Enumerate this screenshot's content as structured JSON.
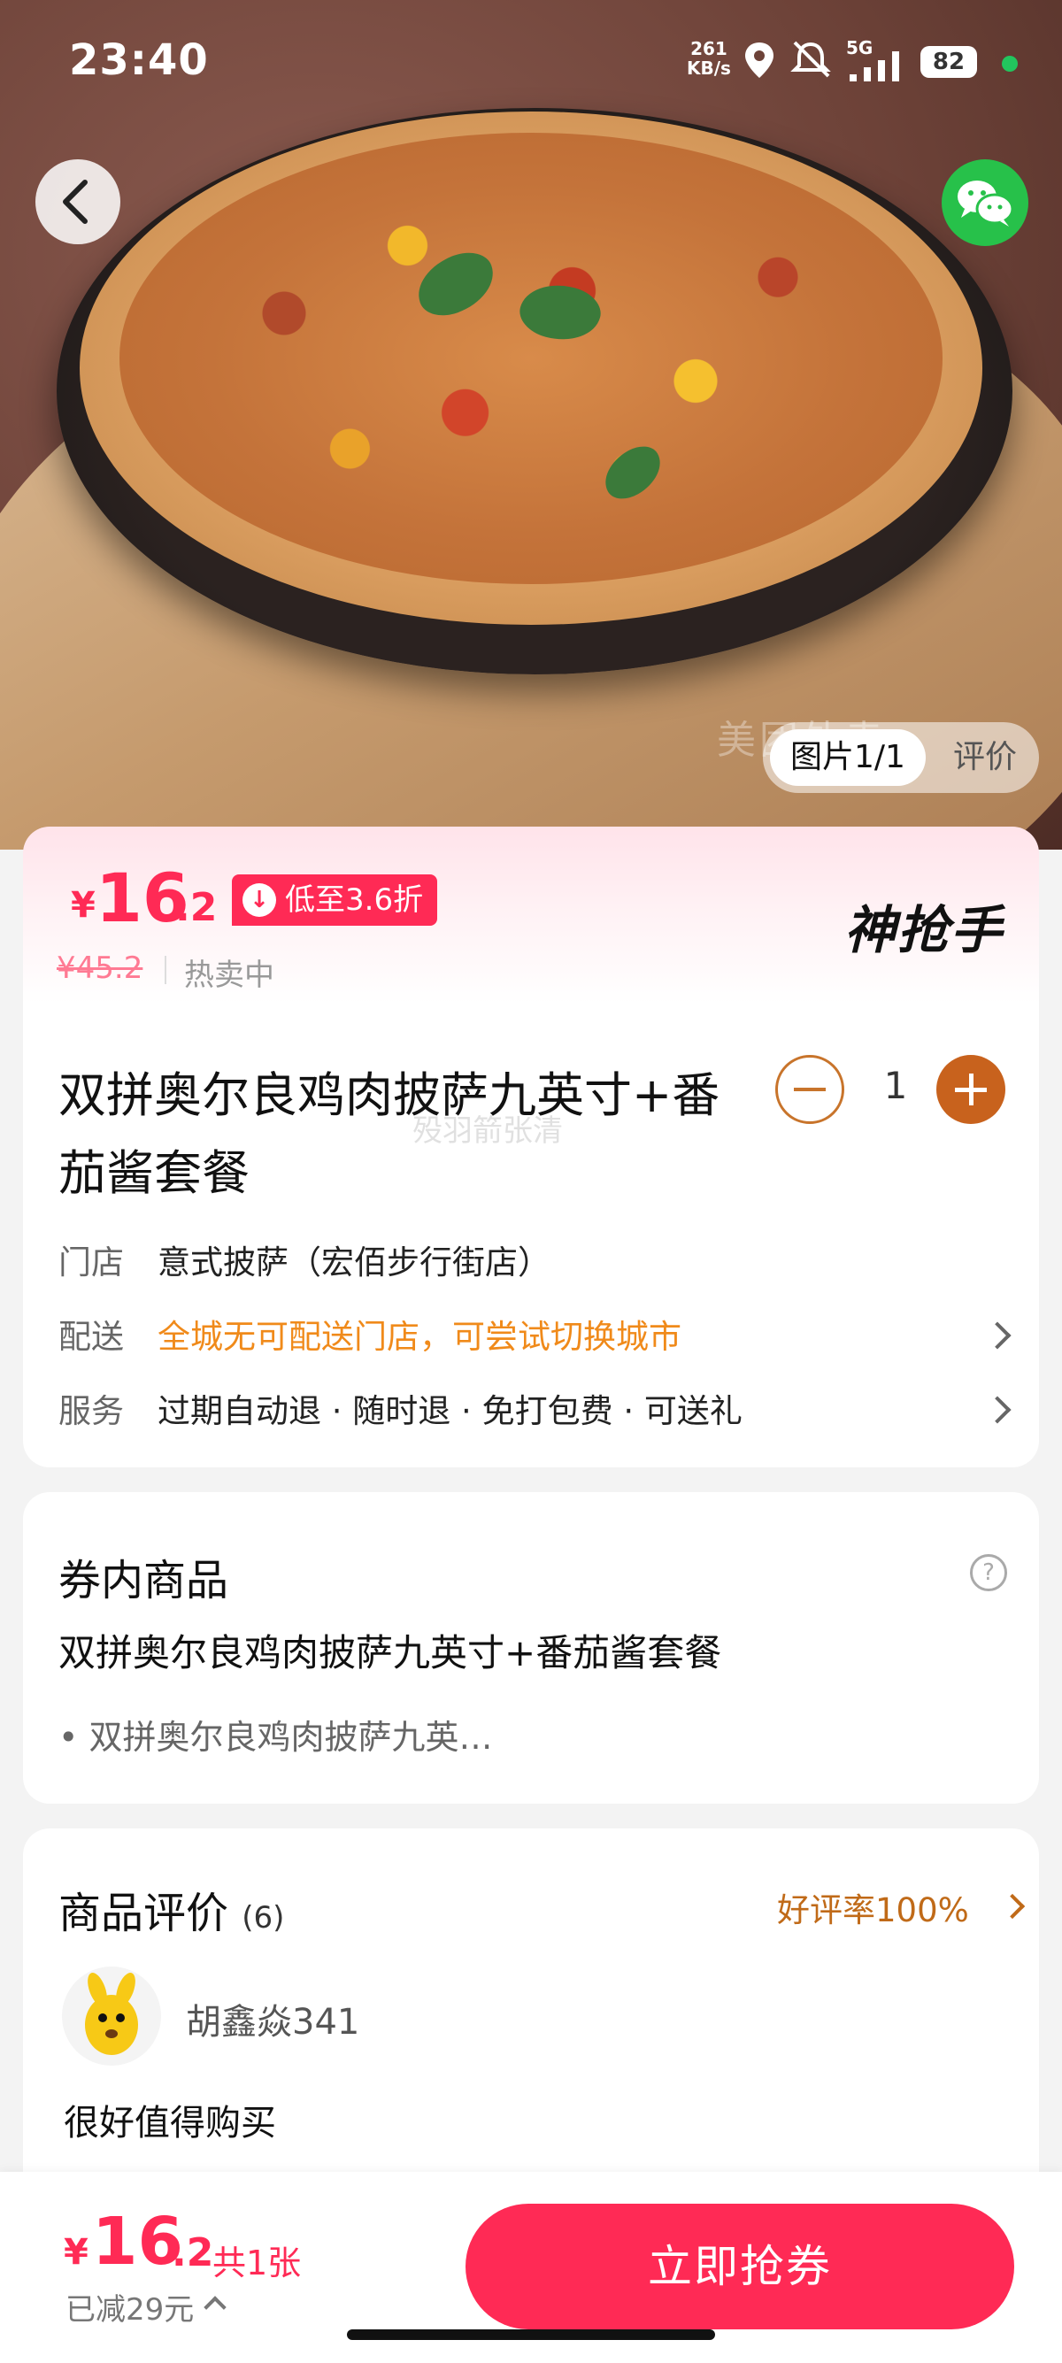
{
  "status_bar": {
    "time": "23:40",
    "net_speed_value": "261",
    "net_speed_unit": "KB/s",
    "network": "5G",
    "battery": "82"
  },
  "hero": {
    "image_tabs": {
      "active": "图片1/1",
      "other": "评价"
    },
    "watermark": "美团外卖"
  },
  "product": {
    "price_symbol": "¥",
    "price_int": "16",
    "price_dec": ".2",
    "discount_badge": "低至3.6折",
    "brand": "神抢手",
    "original_price": "¥45.2",
    "status": "热卖中",
    "title": "双拼奥尔良鸡肉披萨九英寸+番茄酱套餐",
    "watermark": "殁羽箭张清",
    "quantity": "1",
    "store_label": "门店",
    "store_value": "意式披萨（宏佰步行街店）",
    "delivery_label": "配送",
    "delivery_value": "全城无可配送门店，可尝试切换城市",
    "service_label": "服务",
    "service_value": "过期自动退 · 随时退 · 免打包费 · 可送礼",
    "accent_color": "#ff2a55"
  },
  "coupon": {
    "title": "券内商品",
    "help_icon": "?",
    "item": "双拼奥尔良鸡肉披萨九英寸+番茄酱套餐",
    "sub_item": "• 双拼奥尔良鸡肉披萨九英…"
  },
  "reviews": {
    "title": "商品评价",
    "count": "(6)",
    "rate": "好评率100%",
    "user": "胡鑫焱341",
    "text": "很好值得购买"
  },
  "bottom_bar": {
    "price_symbol": "¥",
    "price_int": "16",
    "price_dec": ".2",
    "count": "共1张",
    "saved": "已减29元",
    "buy_button": "立即抢券"
  }
}
